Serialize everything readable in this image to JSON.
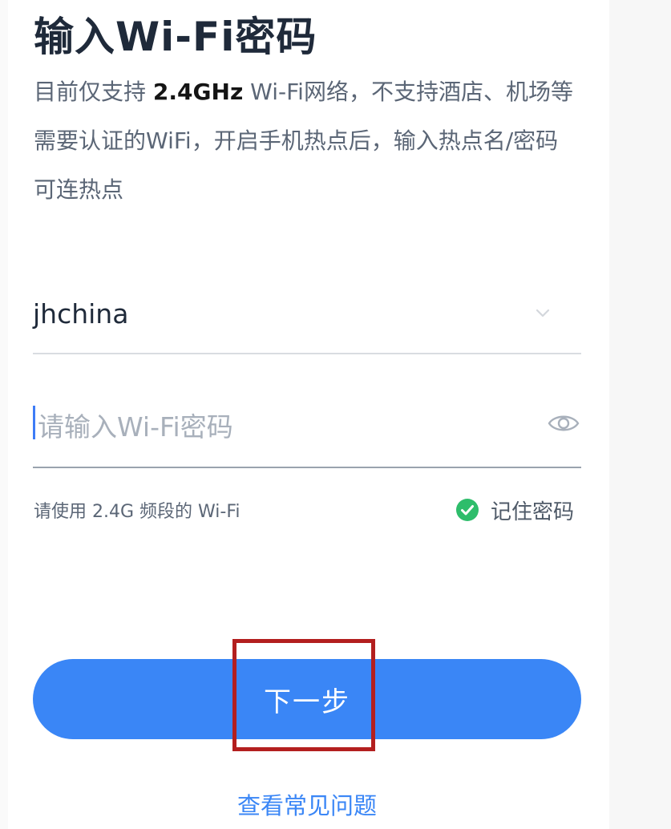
{
  "header": {
    "title": "输入Wi-Fi密码"
  },
  "description": {
    "prefix": "目前仅支持",
    "band": "2.4GHz",
    "suffix": "Wi-Fi网络，不支持酒店、机场等需要认证的WiFi，开启手机热点后，输入热点名/密码可连热点"
  },
  "ssid_field": {
    "value": "jhchina",
    "icon": "chevron-down-icon"
  },
  "password_field": {
    "value": "",
    "placeholder": "请输入Wi-Fi密码",
    "icon": "eye-icon"
  },
  "hint": "请使用 2.4G 频段的 Wi-Fi",
  "remember": {
    "label": "记住密码",
    "checked": true,
    "color": "#2ebd6b",
    "icon": "check-circle-icon"
  },
  "next_button": {
    "label": "下一步",
    "color": "#3a86f6"
  },
  "highlight": {
    "color": "#b31f1f"
  },
  "faq_link": {
    "label": "查看常见问题"
  }
}
